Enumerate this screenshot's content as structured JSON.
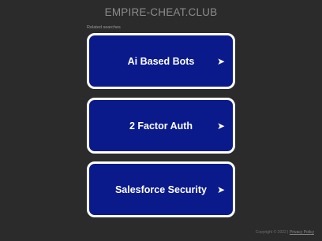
{
  "header": {
    "title": "EMPIRE-CHEAT.CLUB"
  },
  "related": {
    "heading": "Related searches",
    "items": [
      {
        "label": "Ai Based Bots",
        "icon": "arrow-right-icon"
      },
      {
        "label": "2 Factor Auth",
        "icon": "arrow-right-icon"
      },
      {
        "label": "Salesforce Security",
        "icon": "arrow-right-icon"
      }
    ]
  },
  "footer": {
    "copyright": "Copyright © 2022 |",
    "privacy_link": "Privacy Policy"
  },
  "colors": {
    "background": "#2b2b2b",
    "card_bg": "#0a1a8a",
    "card_border": "#ffffff",
    "title_text": "#8c8c8c"
  }
}
